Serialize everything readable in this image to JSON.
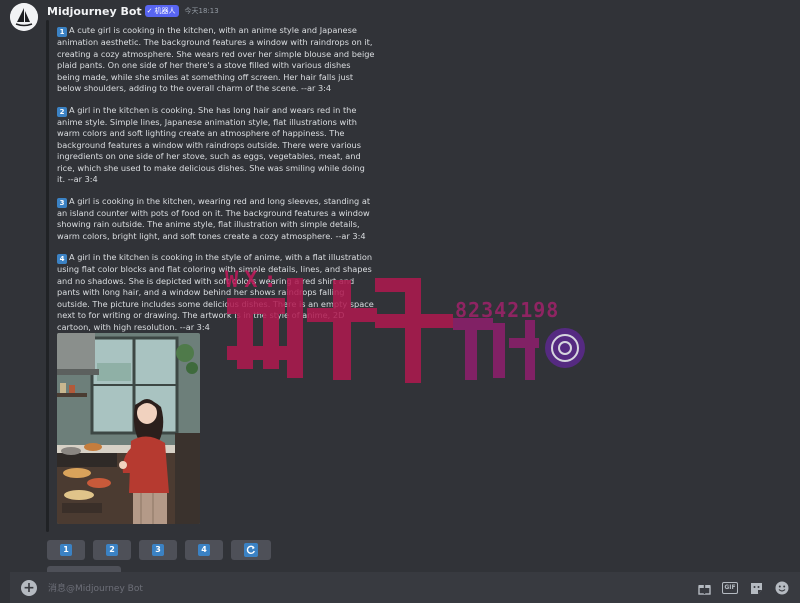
{
  "header": {
    "username": "Midjourney Bot",
    "badge": "机器人",
    "timestamp": "今天18:13"
  },
  "prompts": [
    {
      "num": "1",
      "text": "A cute girl is cooking in the kitchen, with an anime style and Japanese animation aesthetic. The background features a window with raindrops on it, creating a cozy atmosphere. She wears red over her simple blouse and beige plaid pants. On one side of her there's a stove filled with various dishes being made, while she smiles at something off screen. Her hair falls just below shoulders, adding to the overall charm of the scene. --ar 3:4"
    },
    {
      "num": "2",
      "text": "A girl in the kitchen is cooking. She has long hair and wears red in the anime style. Simple lines, Japanese animation style, flat illustrations with warm colors and soft lighting create an atmosphere of happiness. The background features a window with raindrops outside. There were various ingredients on one side of her stove, such as eggs, vegetables, meat, and rice, which she used to make delicious dishes. She was smiling while doing it. --ar 3:4"
    },
    {
      "num": "3",
      "text": "A girl is cooking in the kitchen, wearing red and long sleeves, standing at an island counter with pots of food on it. The background features a window showing rain outside. The anime style, flat illustration with simple details, warm colors, bright light, and soft tones create a cozy atmosphere. --ar 3:4"
    },
    {
      "num": "4",
      "text": "A girl in the kitchen is cooking in the style of anime, with a flat illustration using flat color blocks and flat coloring with simple details, lines, and shapes and no shadows. She is depicted with soft colors wearing a red shirt and pants with long hair, and a window behind her shows raindrops falling outside. The picture includes some delicious dishes. There is an empty space next to for writing or drawing. The artwork is in the style of anime, 2D cartoon, with high resolution. --ar 3:4"
    }
  ],
  "buttons": [
    {
      "label": "1"
    },
    {
      "label": "2"
    },
    {
      "label": "3"
    },
    {
      "label": "4"
    }
  ],
  "watermark": {
    "wx": "WX:",
    "number": "82342198"
  },
  "composer": {
    "placeholder": "消息@Midjourney Bot",
    "icons": [
      "add-icon",
      "gift-icon",
      "gif-icon",
      "sticker-icon",
      "emoji-icon"
    ]
  },
  "colors": {
    "background": "#313338",
    "button": "#4e5058",
    "accent": "#3b82c4",
    "badge": "#5865f2",
    "watermark": "#c2185b"
  }
}
